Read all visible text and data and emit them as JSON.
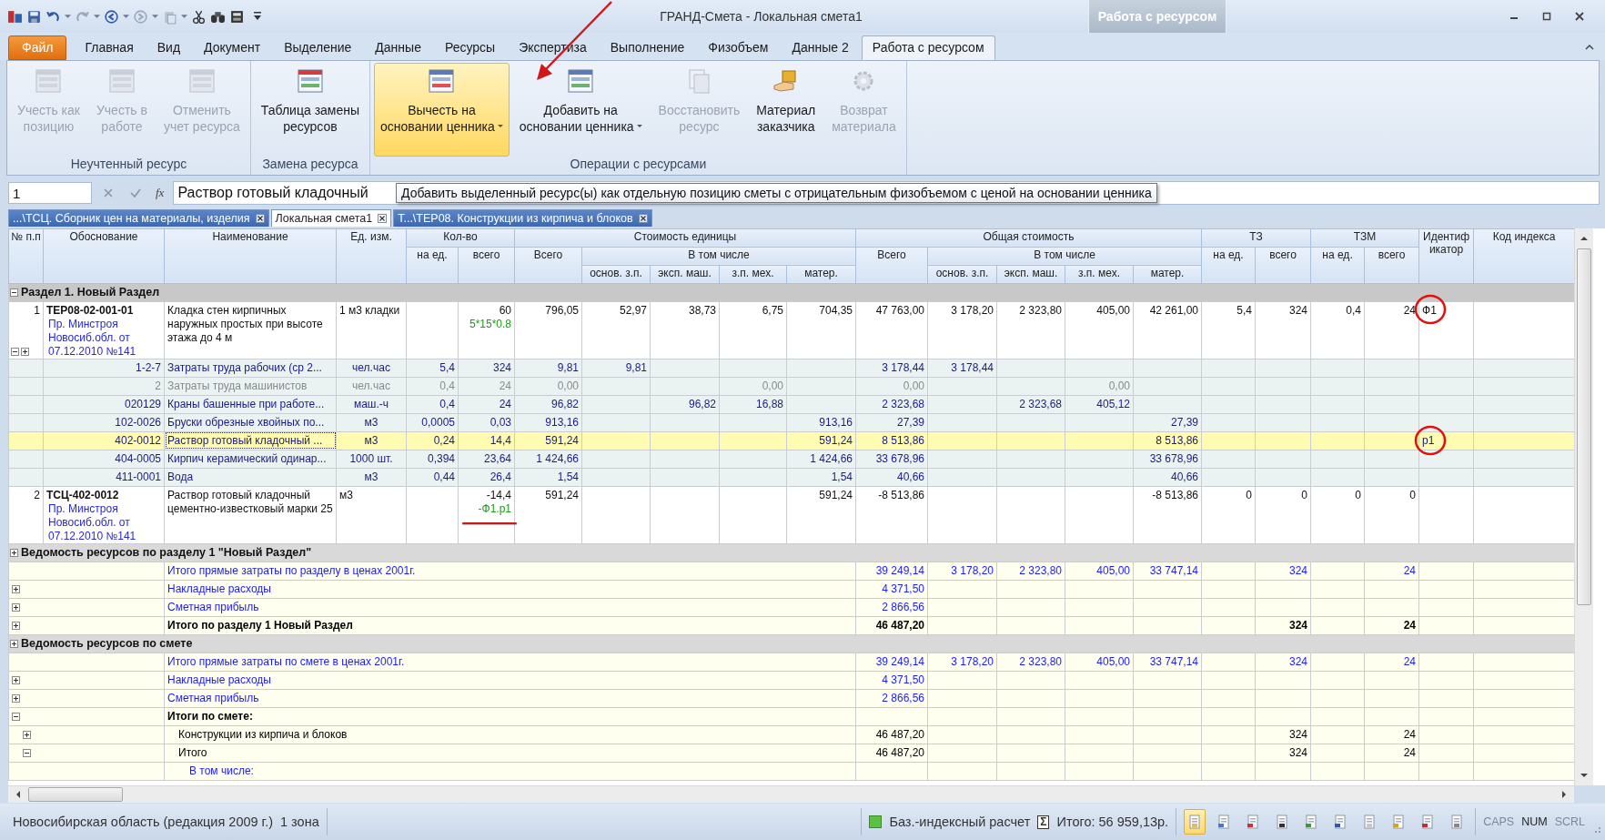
{
  "window": {
    "title": "ГРАНД-Смета - Локальная смета1",
    "context_tab_group": "Работа с ресурсом"
  },
  "ribbon_tabs": [
    {
      "label": "Файл",
      "kind": "file",
      "selected": false
    },
    {
      "label": "Главная",
      "kind": "tab",
      "selected": false
    },
    {
      "label": "Вид",
      "kind": "tab",
      "selected": false
    },
    {
      "label": "Документ",
      "kind": "tab",
      "selected": false
    },
    {
      "label": "Выделение",
      "kind": "tab",
      "selected": false
    },
    {
      "label": "Данные",
      "kind": "tab",
      "selected": false
    },
    {
      "label": "Ресурсы",
      "kind": "tab",
      "selected": false
    },
    {
      "label": "Экспертиза",
      "kind": "tab",
      "selected": false
    },
    {
      "label": "Выполнение",
      "kind": "tab",
      "selected": false
    },
    {
      "label": "Физобъем",
      "kind": "tab",
      "selected": false
    },
    {
      "label": "Данные 2",
      "kind": "tab",
      "selected": false
    },
    {
      "label": "Работа с ресурсом",
      "kind": "tab",
      "selected": true
    }
  ],
  "ribbon_groups": [
    {
      "label": "Неучтенный ресурс",
      "buttons": [
        {
          "lines": [
            "Учесть как",
            "позицию"
          ],
          "disabled": true,
          "highlighted": false,
          "dropdown": false
        },
        {
          "lines": [
            "Учесть в",
            "работе"
          ],
          "disabled": true,
          "highlighted": false,
          "dropdown": false
        },
        {
          "lines": [
            "Отменить",
            "учет ресурса"
          ],
          "disabled": true,
          "highlighted": false,
          "dropdown": false
        }
      ]
    },
    {
      "label": "Замена ресурса",
      "buttons": [
        {
          "lines": [
            "Таблица замены",
            "ресурсов"
          ],
          "disabled": false,
          "highlighted": false,
          "dropdown": false
        }
      ]
    },
    {
      "label": "Операции с ресурсами",
      "buttons": [
        {
          "lines": [
            "Вычесть на",
            "основании ценника"
          ],
          "disabled": false,
          "highlighted": true,
          "dropdown": true
        },
        {
          "lines": [
            "Добавить на",
            "основании ценника"
          ],
          "disabled": false,
          "highlighted": false,
          "dropdown": true
        },
        {
          "lines": [
            "Восстановить",
            "ресурс"
          ],
          "disabled": true,
          "highlighted": false,
          "dropdown": false
        },
        {
          "lines": [
            "Материал",
            "заказчика"
          ],
          "disabled": false,
          "highlighted": false,
          "dropdown": false
        },
        {
          "lines": [
            "Возврат",
            "материала"
          ],
          "disabled": true,
          "highlighted": false,
          "dropdown": false
        }
      ]
    }
  ],
  "formula_bar": {
    "cell": "1",
    "function_button": "fx",
    "value": "Раствор готовый кладочный",
    "tooltip": "Добавить выделенный  ресурс(ы) как отдельную позицию сметы с отрицательным физобъемом с ценой на основании ценника"
  },
  "document_tabs": [
    {
      "label": "...\\ТСЦ. Сборник цен на материалы, изделия",
      "selected": false
    },
    {
      "label": "Локальная смета1",
      "selected": true
    },
    {
      "label": "Т...\\ТЕР08. Конструкции из кирпича и блоков",
      "selected": false
    }
  ],
  "table": {
    "columns": [
      {
        "label": "№ п.п"
      },
      {
        "label": "Обоснование"
      },
      {
        "label": "Наименование"
      },
      {
        "label": "Ед. изм."
      },
      {
        "label": "Кол-во",
        "children": [
          {
            "label": "на ед."
          },
          {
            "label": "всего"
          }
        ]
      },
      {
        "label": "Стоимость единицы",
        "children": [
          {
            "label": "Всего"
          },
          {
            "label": "В том числе",
            "children": [
              {
                "label": "основ. з.п."
              },
              {
                "label": "эксп. маш."
              },
              {
                "label": "з.п. мех."
              },
              {
                "label": "матер."
              }
            ]
          }
        ]
      },
      {
        "label": "Общая стоимость",
        "children": [
          {
            "label": "Всего"
          },
          {
            "label": "В том числе",
            "children": [
              {
                "label": "основ. з.п."
              },
              {
                "label": "эксп. маш."
              },
              {
                "label": "з.п. мех."
              },
              {
                "label": "матер."
              }
            ]
          }
        ]
      },
      {
        "label": "ТЗ",
        "children": [
          {
            "label": "на ед."
          },
          {
            "label": "всего"
          }
        ]
      },
      {
        "label": "ТЗМ",
        "children": [
          {
            "label": "на ед."
          },
          {
            "label": "всего"
          }
        ]
      },
      {
        "label": "Идентификатор"
      },
      {
        "label": "Код индекса"
      }
    ],
    "rows": [
      {
        "kind": "section",
        "label": "Раздел 1. Новый Раздел",
        "expanded": true
      },
      {
        "kind": "position",
        "selected": false,
        "expanded": true,
        "note": "Пр. Минстроя Новосиб.обл. от 07.12.2010 №141",
        "formula": "5*15*0.8",
        "cells": {
          "num": "1",
          "basis": "ТЕР08-02-001-01",
          "name": "Кладка стен кирпичных наружных простых при высоте этажа до 4 м",
          "unit": "1 м3 кладки",
          "qty_total": "60",
          "u_all": "796,05",
          "u_wage": "52,97",
          "u_mach": "38,73",
          "u_mech": "6,75",
          "u_mat": "704,35",
          "t_all": "47 763,00",
          "t_wage": "3 178,20",
          "t_mach": "2 323,80",
          "t_mech": "405,00",
          "t_mat": "42 261,00",
          "tz_unit": "5,4",
          "tz_total": "324",
          "tzm_unit": "0,4",
          "tzm_total": "24",
          "ident": "Ф1"
        }
      },
      {
        "kind": "resource",
        "selected": false,
        "dimmed": false,
        "cells": {
          "basis": "1-2-7",
          "name": "Затраты труда рабочих (ср 2...",
          "unit": "чел.час",
          "qty_unit": "5,4",
          "qty_total": "324",
          "u_all": "9,81",
          "u_wage": "9,81",
          "t_all": "3 178,44",
          "t_wage": "3 178,44"
        }
      },
      {
        "kind": "resource",
        "selected": false,
        "dimmed": true,
        "cells": {
          "basis": "2",
          "name": "Затраты труда машинистов",
          "unit": "чел.час",
          "qty_unit": "0,4",
          "qty_total": "24",
          "u_all": "0,00",
          "u_mech": "0,00",
          "t_all": "0,00",
          "t_mech": "0,00"
        }
      },
      {
        "kind": "resource",
        "selected": false,
        "dimmed": false,
        "cells": {
          "basis": "020129",
          "name": "Краны башенные при работе...",
          "unit": "маш.-ч",
          "qty_unit": "0,4",
          "qty_total": "24",
          "u_all": "96,82",
          "u_mach": "96,82",
          "u_mech": "16,88",
          "t_all": "2 323,68",
          "t_mach": "2 323,68",
          "t_mech": "405,12"
        }
      },
      {
        "kind": "resource",
        "selected": false,
        "dimmed": false,
        "cells": {
          "basis": "102-0026",
          "name": "Бруски обрезные хвойных по...",
          "unit": "м3",
          "qty_unit": "0,0005",
          "qty_total": "0,03",
          "u_all": "913,16",
          "u_mat": "913,16",
          "t_all": "27,39",
          "t_mat": "27,39"
        }
      },
      {
        "kind": "resource",
        "selected": true,
        "dimmed": false,
        "cells": {
          "basis": "402-0012",
          "name": "Раствор готовый кладочный ...",
          "unit": "м3",
          "qty_unit": "0,24",
          "qty_total": "14,4",
          "u_all": "591,24",
          "u_mat": "591,24",
          "t_all": "8 513,86",
          "t_mat": "8 513,86",
          "ident": "р1"
        }
      },
      {
        "kind": "resource",
        "selected": false,
        "dimmed": false,
        "cells": {
          "basis": "404-0005",
          "name": "Кирпич керамический одинар...",
          "unit": "1000 шт.",
          "qty_unit": "0,394",
          "qty_total": "23,64",
          "u_all": "1 424,66",
          "u_mat": "1 424,66",
          "t_all": "33 678,96",
          "t_mat": "33 678,96"
        }
      },
      {
        "kind": "resource",
        "selected": false,
        "dimmed": false,
        "cells": {
          "basis": "411-0001",
          "name": "Вода",
          "unit": "м3",
          "qty_unit": "0,44",
          "qty_total": "26,4",
          "u_all": "1,54",
          "u_mat": "1,54",
          "t_all": "40,66",
          "t_mat": "40,66"
        }
      },
      {
        "kind": "position",
        "selected": false,
        "note": "Пр. Минстроя Новосиб.обл. от 07.12.2010 №141",
        "formula": "-Ф1.р1",
        "cells": {
          "num": "2",
          "basis": "ТСЦ-402-0012",
          "name": "Раствор готовый кладочный цементно-известковый марки 25",
          "unit": "м3",
          "qty_total": "-14,4",
          "u_all": "591,24",
          "u_mat": "591,24",
          "t_all": "-8 513,86",
          "t_mat": "-8 513,86",
          "tz_unit": "0",
          "tz_total": "0",
          "tzm_unit": "0",
          "tzm_total": "0"
        }
      },
      {
        "kind": "section",
        "label": "Ведомость ресурсов по разделу 1 \"Новый Раздел\"",
        "expanded": false
      },
      {
        "kind": "subtotal",
        "label": "Итого прямые затраты по разделу в ценах 2001г.",
        "cells": {
          "t_all": "39 249,14",
          "t_wage": "3 178,20",
          "t_mach": "2 323,80",
          "t_mech": "405,00",
          "t_mat": "33 747,14",
          "tz_total": "324",
          "tzm_total": "24"
        }
      },
      {
        "kind": "subtotal",
        "label": "Накладные расходы",
        "expanded": false,
        "cells": {
          "t_all": "4 371,50"
        }
      },
      {
        "kind": "subtotal",
        "label": "Сметная прибыль",
        "expanded": false,
        "cells": {
          "t_all": "2 866,56"
        }
      },
      {
        "kind": "total",
        "label": "Итого по разделу 1 Новый Раздел",
        "expanded": false,
        "cells": {
          "t_all": "46 487,20",
          "tz_total": "324",
          "tzm_total": "24"
        }
      },
      {
        "kind": "section",
        "label": "Ведомость ресурсов по смете",
        "expanded": false
      },
      {
        "kind": "subtotal",
        "label": "Итого прямые затраты по смете в ценах 2001г.",
        "cells": {
          "t_all": "39 249,14",
          "t_wage": "3 178,20",
          "t_mach": "2 323,80",
          "t_mech": "405,00",
          "t_mat": "33 747,14",
          "tz_total": "324",
          "tzm_total": "24"
        }
      },
      {
        "kind": "subtotal",
        "label": "Накладные расходы",
        "expanded": false,
        "cells": {
          "t_all": "4 371,50"
        }
      },
      {
        "kind": "subtotal",
        "label": "Сметная прибыль",
        "expanded": false,
        "cells": {
          "t_all": "2 866,56"
        }
      },
      {
        "kind": "total",
        "label": "Итоги по смете:",
        "expanded": true,
        "children": [
          {
            "kind": "line",
            "label": "Конструкции из кирпича и блоков",
            "expanded": false,
            "cells": {
              "t_all": "46 487,20",
              "tz_total": "324",
              "tzm_total": "24"
            }
          },
          {
            "kind": "line",
            "label": "Итого",
            "expanded": true,
            "cells": {
              "t_all": "46 487,20",
              "tz_total": "324",
              "tzm_total": "24"
            },
            "children": [
              {
                "kind": "subtotal",
                "label": "В том числе:"
              }
            ]
          }
        ]
      }
    ]
  },
  "status_bar": {
    "region": "Новосибирская область (редакция 2009 г.)",
    "zone": "1 зона",
    "mode": "Баз.-индексный расчет",
    "sum_symbol": "Σ",
    "total": "Итого: 56 959,13р.",
    "view_buttons": [
      {
        "selected": true
      },
      {
        "selected": false
      },
      {
        "selected": false
      },
      {
        "selected": false
      },
      {
        "selected": false
      },
      {
        "selected": false
      },
      {
        "selected": false
      },
      {
        "selected": false
      },
      {
        "selected": false
      },
      {
        "selected": false
      }
    ],
    "indicators": [
      {
        "label": "CAPS",
        "on": false
      },
      {
        "label": "NUM",
        "on": true
      },
      {
        "label": "SCRL",
        "on": false
      }
    ]
  }
}
